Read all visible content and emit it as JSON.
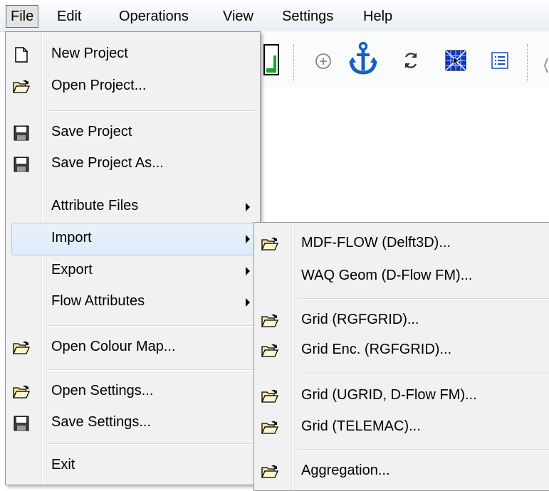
{
  "menubar": {
    "items": [
      "File",
      "Edit",
      "Operations",
      "View",
      "Settings",
      "Help"
    ]
  },
  "toolbar": {
    "icons": [
      "grid-color-icon",
      "zoom-circle-icon",
      "anchor-icon",
      "refresh-icon",
      "hatch-grid-icon",
      "list-icon"
    ],
    "anchor_color": "#1560bd"
  },
  "file_menu": {
    "items": [
      {
        "label": "New Project",
        "icon": "new-file-icon"
      },
      {
        "label": "Open Project...",
        "icon": "open-folder-icon"
      },
      {
        "label": "Save Project",
        "icon": "floppy-disk-icon"
      },
      {
        "label": "Save Project As...",
        "icon": "floppy-disk-icon"
      },
      {
        "label": "Attribute Files",
        "icon": "",
        "submenu": true
      },
      {
        "label": "Import",
        "icon": "",
        "submenu": true
      },
      {
        "label": "Export",
        "icon": "",
        "submenu": true
      },
      {
        "label": "Flow Attributes",
        "icon": "",
        "submenu": true
      },
      {
        "label": "Open Colour Map...",
        "icon": "open-folder-icon"
      },
      {
        "label": "Open Settings...",
        "icon": "open-folder-icon"
      },
      {
        "label": "Save Settings...",
        "icon": "floppy-disk-icon"
      },
      {
        "label": "Exit",
        "icon": ""
      }
    ]
  },
  "import_menu": {
    "items": [
      {
        "label": "MDF-FLOW (Delft3D)...",
        "icon": "open-folder-icon"
      },
      {
        "label": "WAQ Geom (D-Flow FM)...",
        "icon": ""
      },
      {
        "label": "Grid (RGFGRID)...",
        "icon": "open-folder-icon"
      },
      {
        "label": "Grid Enc. (RGFGRID)...",
        "icon": "open-folder-icon"
      },
      {
        "label": "Grid (UGRID, D-Flow FM)...",
        "icon": "open-folder-icon"
      },
      {
        "label": "Grid (TELEMAC)...",
        "icon": "open-folder-icon"
      },
      {
        "label": "Aggregation...",
        "icon": "open-folder-icon"
      }
    ]
  }
}
